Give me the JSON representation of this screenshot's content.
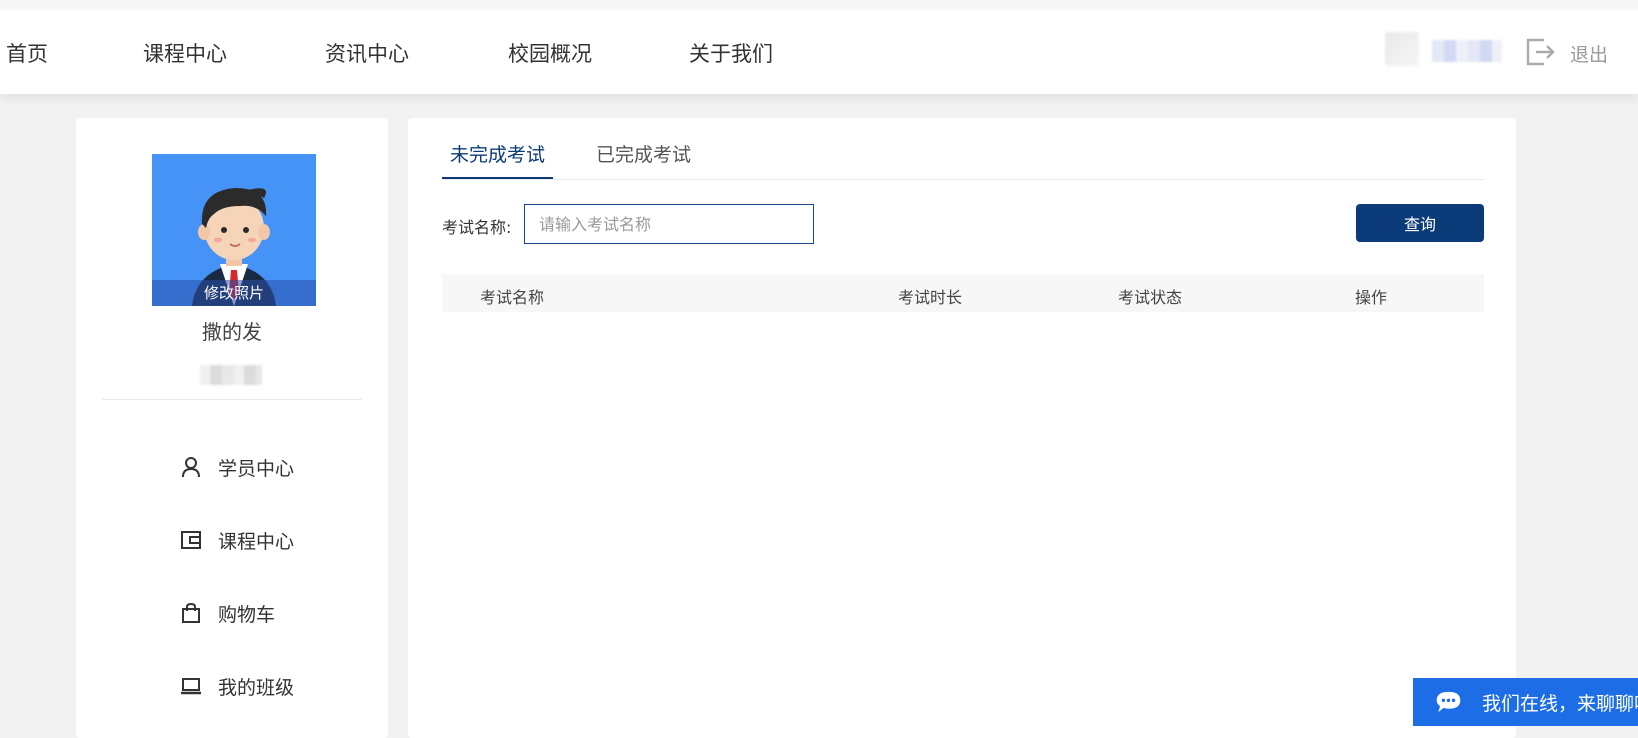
{
  "nav": {
    "items": [
      {
        "label": "首页"
      },
      {
        "label": "课程中心"
      },
      {
        "label": "资讯中心"
      },
      {
        "label": "校园概况"
      },
      {
        "label": "关于我们"
      }
    ],
    "logout_label": "退出"
  },
  "profile": {
    "change_photo_label": "修改照片",
    "name": "撒的发"
  },
  "sidebar": {
    "items": [
      {
        "label": "学员中心",
        "icon": "user-icon"
      },
      {
        "label": "课程中心",
        "icon": "wallet-icon"
      },
      {
        "label": "购物车",
        "icon": "shopping-bag-icon"
      },
      {
        "label": "我的班级",
        "icon": "laptop-icon"
      }
    ]
  },
  "tabs": [
    {
      "label": "未完成考试",
      "active": true
    },
    {
      "label": "已完成考试",
      "active": false
    }
  ],
  "search": {
    "label": "考试名称:",
    "placeholder": "请输入考试名称",
    "value": "",
    "button_label": "查询"
  },
  "table": {
    "columns": [
      "考试名称",
      "考试时长",
      "考试状态",
      "操作"
    ],
    "rows": []
  },
  "chat": {
    "text": "我们在线，来聊聊吧"
  },
  "colors": {
    "primary": "#0c3b7a",
    "photo_bg": "#4593f7",
    "chat_bg": "#1d6ee6",
    "page_bg": "#f2f2f2"
  }
}
